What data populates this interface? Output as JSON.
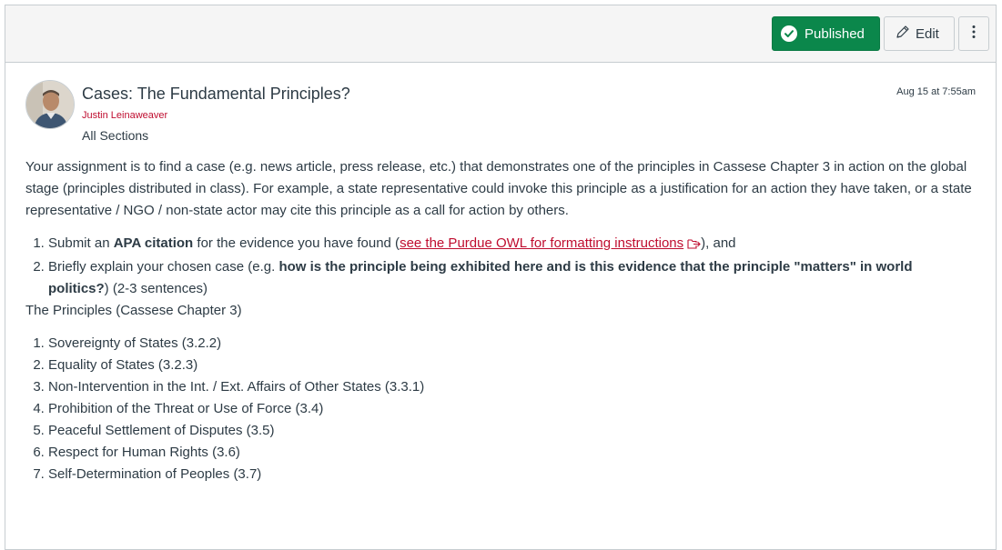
{
  "toolbar": {
    "published_label": "Published",
    "edit_label": "Edit",
    "more_icon": "kebab-vertical-icon",
    "colors": {
      "published_bg": "#0b874b"
    }
  },
  "post": {
    "title": "Cases: The Fundamental Principles?",
    "author": "Justin Leinaweaver",
    "sections": "All Sections",
    "date": "Aug 15 at 7:55am",
    "author_color": "#bf0d2f"
  },
  "body": {
    "intro": "Your assignment is to find a case (e.g. news article, press release, etc.) that demonstrates one of the principles in Cassese Chapter 3 in action on the global stage (principles distributed in class). For example, a state representative could invoke this principle as a justification for an action they have taken, or a state representative / NGO / non-state actor may cite this principle as a call for action by others.",
    "instructions": {
      "item1": {
        "pre": "Submit an ",
        "bold": "APA citation",
        "mid": " for the evidence you have found (",
        "link": "see the Purdue OWL for formatting instructions",
        "post": "), and"
      },
      "item2": {
        "pre": "Briefly explain your chosen case (e.g. ",
        "bold": "how is the principle being exhibited here and is this evidence that the principle \"matters\" in world politics?",
        "post": ") (2-3 sentences)"
      }
    },
    "principles_heading": "The Principles (Cassese Chapter 3)",
    "principles": [
      "Sovereignty of States (3.2.2)",
      "Equality of States (3.2.3)",
      "Non-Intervention in the Int. / Ext. Affairs of Other States (3.3.1)",
      "Prohibition of the Threat or Use of Force (3.4)",
      "Peaceful Settlement of Disputes (3.5)",
      "Respect for Human Rights (3.6)",
      "Self-Determination of Peoples (3.7)"
    ]
  }
}
